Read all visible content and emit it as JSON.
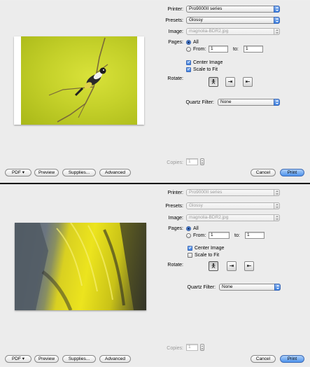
{
  "dialogs": [
    {
      "printer_label": "Printer:",
      "printer_value": "Pro9000II series",
      "presets_label": "Presets:",
      "presets_value": "Glossy",
      "image_label": "Image:",
      "image_value": "magnolia-BDR2.jpg",
      "pages_label": "Pages:",
      "all_label": "All",
      "from_label": "From:",
      "from_value": "1",
      "to_label": "to:",
      "to_value": "1",
      "center_image_label": "Center Image",
      "center_image_checked": true,
      "scale_to_fit_label": "Scale to Fit",
      "scale_to_fit_checked": true,
      "rotate_label": "Rotate:",
      "quartz_label": "Quartz Filter:",
      "quartz_value": "None",
      "copies_label": "Copies:",
      "copies_value": "1",
      "pdf_label": "PDF ▾",
      "preview_label": "Preview",
      "supplies_label": "Supplies...",
      "advanced_label": "Advanced",
      "cancel_label": "Cancel",
      "print_label": "Print"
    },
    {
      "printer_label": "Printer:",
      "printer_value": "Pro9000II series",
      "presets_label": "Presets:",
      "presets_value": "Glossy",
      "image_label": "Image:",
      "image_value": "magnolia-BDR2.jpg",
      "pages_label": "Pages:",
      "all_label": "All",
      "from_label": "From:",
      "from_value": "1",
      "to_label": "to:",
      "to_value": "1",
      "center_image_label": "Center Image",
      "center_image_checked": true,
      "scale_to_fit_label": "Scale to Fit",
      "scale_to_fit_checked": false,
      "rotate_label": "Rotate:",
      "quartz_label": "Quartz Filter:",
      "quartz_value": "None",
      "copies_label": "Copies:",
      "copies_value": "1",
      "pdf_label": "PDF ▾",
      "preview_label": "Preview",
      "supplies_label": "Supplies...",
      "advanced_label": "Advanced",
      "cancel_label": "Cancel",
      "print_label": "Print"
    }
  ],
  "icons": {
    "rotate_portrait": "person-upright-icon",
    "rotate_right": "rotate-right-icon",
    "rotate_left": "rotate-left-icon",
    "popup_arrows": "up-down-arrows-icon"
  },
  "colors": {
    "accent_blue": "#3a7ee0",
    "photo1_background": "#c8d42a",
    "photo2_feathers_yellow": "#e8e21c"
  }
}
